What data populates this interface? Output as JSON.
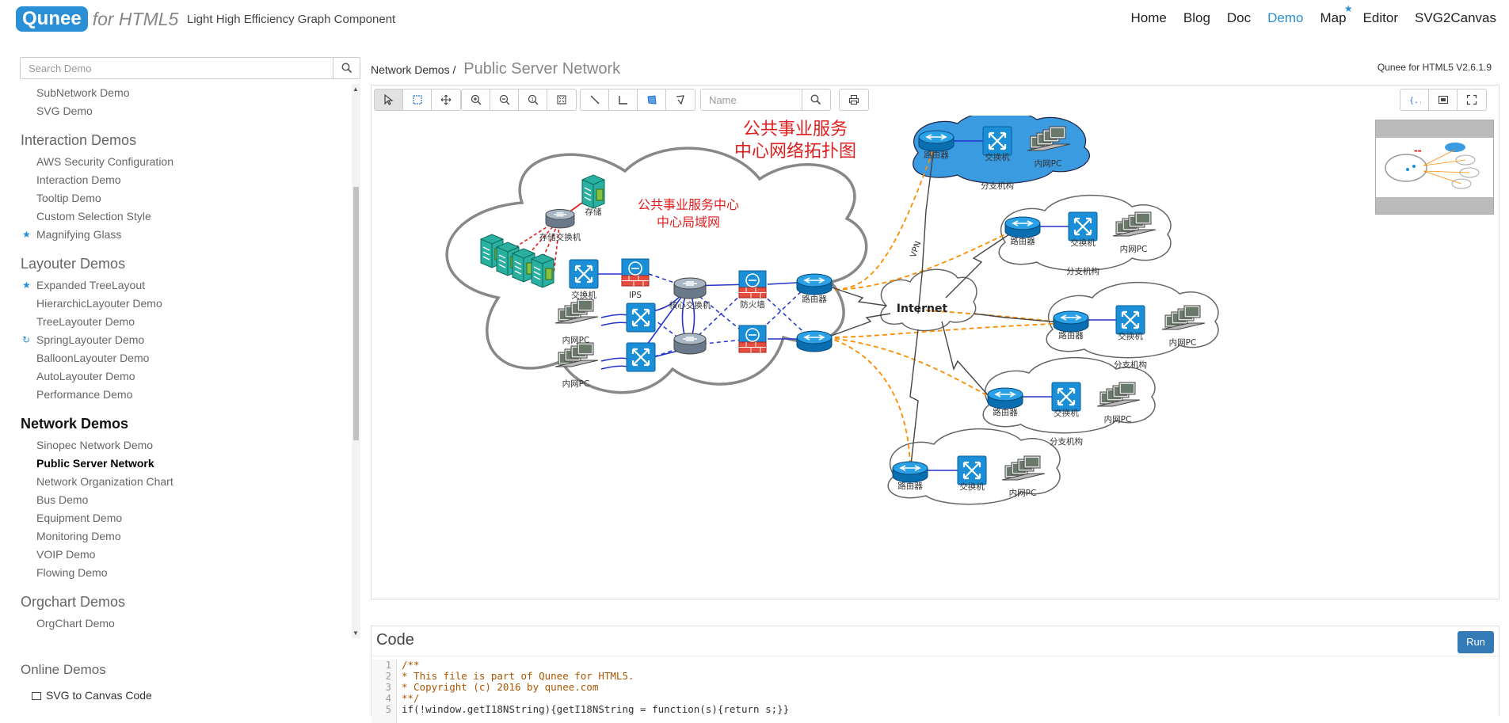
{
  "header": {
    "logo_main": "Qunee",
    "logo_suffix": "for HTML5",
    "tagline": "Light High Efficiency Graph Component",
    "nav": [
      "Home",
      "Blog",
      "Doc",
      "Demo",
      "Map",
      "Editor",
      "SVG2Canvas"
    ],
    "active_nav": "Demo"
  },
  "sidebar": {
    "search_placeholder": "Search Demo",
    "groups": [
      {
        "title": "",
        "items": [
          {
            "label": "SubNetwork Demo"
          },
          {
            "label": "SVG Demo"
          }
        ]
      },
      {
        "title": "Interaction Demos",
        "items": [
          {
            "label": "AWS Security Configuration"
          },
          {
            "label": "Interaction Demo"
          },
          {
            "label": "Tooltip Demo"
          },
          {
            "label": "Custom Selection Style"
          },
          {
            "label": "Magnifying Glass",
            "marker": "star"
          }
        ]
      },
      {
        "title": "Layouter Demos",
        "items": [
          {
            "label": "Expanded TreeLayout",
            "marker": "star"
          },
          {
            "label": "HierarchicLayouter Demo"
          },
          {
            "label": "TreeLayouter Demo"
          },
          {
            "label": "SpringLayouter Demo",
            "marker": "refresh"
          },
          {
            "label": "BalloonLayouter Demo"
          },
          {
            "label": "AutoLayouter Demo"
          },
          {
            "label": "Performance Demo"
          }
        ]
      },
      {
        "title": "Network Demos",
        "active": true,
        "items": [
          {
            "label": "Sinopec Network Demo"
          },
          {
            "label": "Public Server Network",
            "active": true
          },
          {
            "label": "Network Organization Chart"
          },
          {
            "label": "Bus Demo"
          },
          {
            "label": "Equipment Demo"
          },
          {
            "label": "Monitoring Demo"
          },
          {
            "label": "VOIP Demo"
          },
          {
            "label": "Flowing Demo"
          }
        ]
      },
      {
        "title": "Orgchart Demos",
        "items": [
          {
            "label": "OrgChart Demo"
          }
        ]
      }
    ],
    "online_title": "Online Demos",
    "online_items": [
      "SVG to Canvas Code"
    ]
  },
  "content": {
    "breadcrumb_parent": "Network Demos",
    "breadcrumb_sep": "/",
    "breadcrumb_current": "Public Server Network",
    "version": "Qunee for HTML5 V2.6.1.9",
    "name_placeholder": "Name"
  },
  "graph": {
    "title_line1": "公共事业服务",
    "title_line2": "中心网络拓扑图",
    "lan_title_line1": "公共事业服务中心",
    "lan_title_line2": "中心局域网",
    "labels": {
      "storage": "存储",
      "storage_switch": "存储交换机",
      "switch": "交换机",
      "ips": "IPS",
      "core_switch": "核心交换机",
      "firewall": "防火墙",
      "router": "路由器",
      "lan_pc": "内网PC",
      "internet": "Internet",
      "vpn": "VPN",
      "branch": "分支机构"
    },
    "colors": {
      "title_red": "#e02020",
      "link_blue": "#2233cc",
      "vpn_orange": "#ff8c00",
      "cloud_blue": "#3a9be0"
    }
  },
  "code": {
    "title": "Code",
    "run_label": "Run",
    "lines": [
      {
        "n": "1",
        "t": "/**",
        "c": "cm"
      },
      {
        "n": "2",
        "t": "* This file is part of Qunee for HTML5.",
        "c": "cm"
      },
      {
        "n": "3",
        "t": "* Copyright (c) 2016 by qunee.com",
        "c": "cm"
      },
      {
        "n": "4",
        "t": "**/",
        "c": "cm"
      },
      {
        "n": "5",
        "t": "if(!window.getI18NString){getI18NString = function(s){return s;}}",
        "c": ""
      }
    ]
  }
}
